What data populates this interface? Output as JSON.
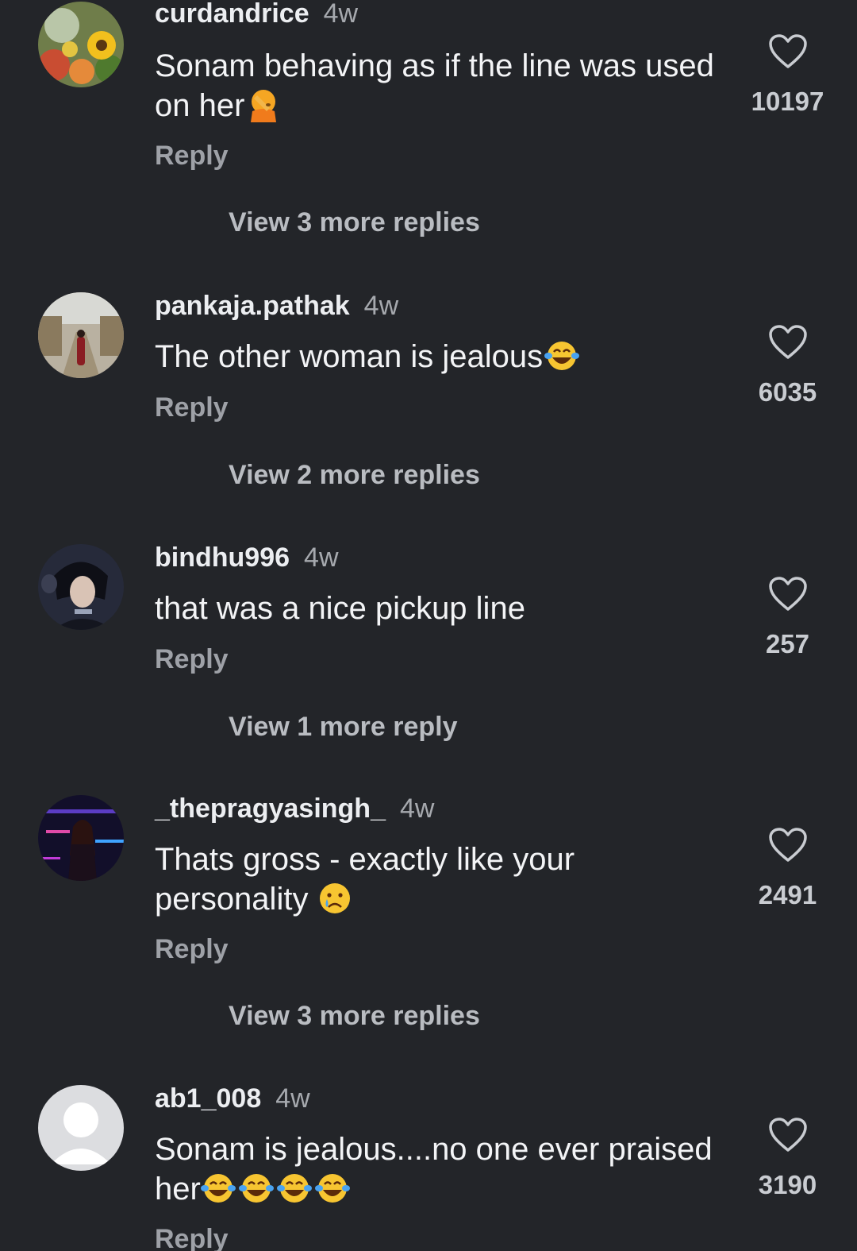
{
  "comments": [
    {
      "username": "curdandrice",
      "time": "4w",
      "text": "Sonam behaving as if the line was used on her",
      "emojis": [
        "facepalm-emoji"
      ],
      "reply_label": "Reply",
      "view_replies": "View 3 more replies",
      "likes": "10197",
      "avatar": "sunflower-avatar"
    },
    {
      "username": "pankaja.pathak",
      "time": "4w",
      "text": "The other woman is jealous",
      "emojis": [
        "tears-of-joy-emoji"
      ],
      "reply_label": "Reply",
      "view_replies": "View 2 more replies",
      "likes": "6035",
      "avatar": "street-photo-avatar"
    },
    {
      "username": "bindhu996",
      "time": "4w",
      "text": "that was a nice pickup line",
      "emojis": [],
      "reply_label": "Reply",
      "view_replies": "View 1 more reply",
      "likes": "257",
      "avatar": "portrait-avatar"
    },
    {
      "username": "_thepragyasingh_",
      "time": "4w",
      "text": "Thats gross - exactly like your personality",
      "emojis": [
        "crying-face-emoji"
      ],
      "reply_label": "Reply",
      "view_replies": "View 3 more replies",
      "likes": "2491",
      "avatar": "neon-photo-avatar"
    },
    {
      "username": "ab1_008",
      "time": "4w",
      "text": "Sonam is jealous....no one ever praised her",
      "emojis": [
        "tears-of-joy-emoji",
        "tears-of-joy-emoji",
        "tears-of-joy-emoji",
        "tears-of-joy-emoji"
      ],
      "reply_label": "Reply",
      "likes": "3190",
      "avatar": "default-avatar"
    }
  ],
  "icons": {
    "like": "heart-outline-icon"
  },
  "colors": {
    "background": "#232529",
    "username": "#eceef1",
    "secondary": "#a6a9ae",
    "text": "#f3f4f6"
  }
}
